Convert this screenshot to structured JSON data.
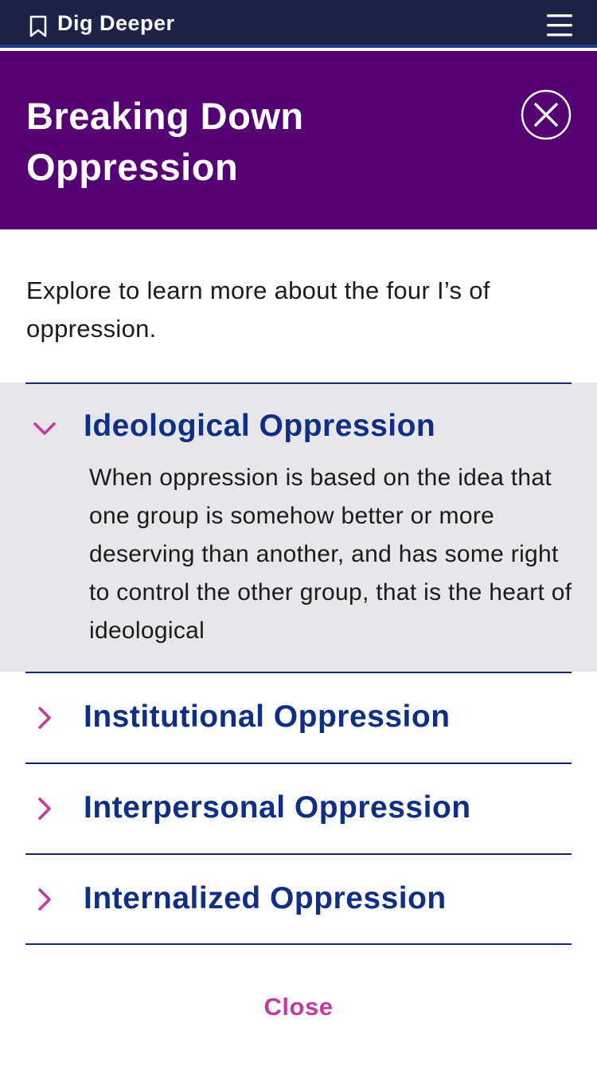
{
  "topbar": {
    "bookmark_icon": "bookmark-icon",
    "title": "Dig Deeper",
    "menu_icon": "hamburger-menu-icon",
    "bg": "#1d2249"
  },
  "header": {
    "title": "Breaking Down Oppression",
    "close_icon": "close-circle-icon",
    "bg": "#560173"
  },
  "intro": "Explore to learn more about the four I’s of oppression.",
  "accordion": {
    "items": [
      {
        "label": "Ideological Oppression",
        "expanded": true,
        "body": "When oppression is based on the idea that one group is somehow better or more deserving than another, and has some right to control the other group, that is the heart of ideological"
      },
      {
        "label": "Institutional Oppression",
        "expanded": false
      },
      {
        "label": "Interpersonal Oppression",
        "expanded": false
      },
      {
        "label": "Internalized Oppression",
        "expanded": false
      }
    ],
    "heading_color": "#0f2f86",
    "chevron_color": "#c7399a",
    "open_bg": "#e6e6eb"
  },
  "footer": {
    "close_label": "Close"
  }
}
